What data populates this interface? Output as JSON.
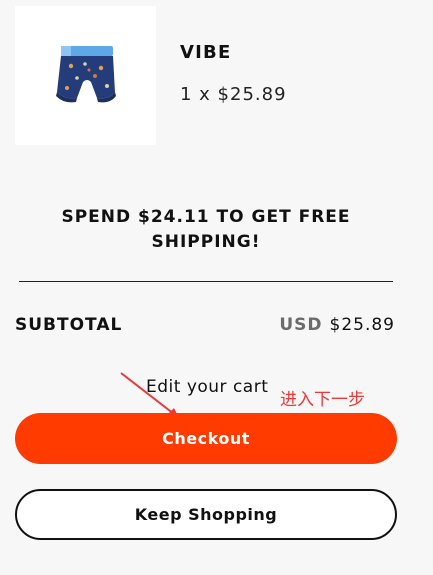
{
  "product": {
    "name": "VIBE",
    "quantity_price": "1 x $25.89",
    "image_icon": "boxer-brief-icon"
  },
  "promo": {
    "text": "SPEND $24.11 TO GET FREE SHIPPING!"
  },
  "subtotal": {
    "label": "SUBTOTAL",
    "currency": "USD",
    "amount": "$25.89"
  },
  "edit_cart_label": "Edit your cart",
  "annotation": {
    "text": "进入下一步",
    "color": "#e8393b"
  },
  "buttons": {
    "checkout_label": "Checkout",
    "keep_shopping_label": "Keep Shopping"
  },
  "colors": {
    "accent": "#ff3b00",
    "background": "#f7f7f7"
  }
}
